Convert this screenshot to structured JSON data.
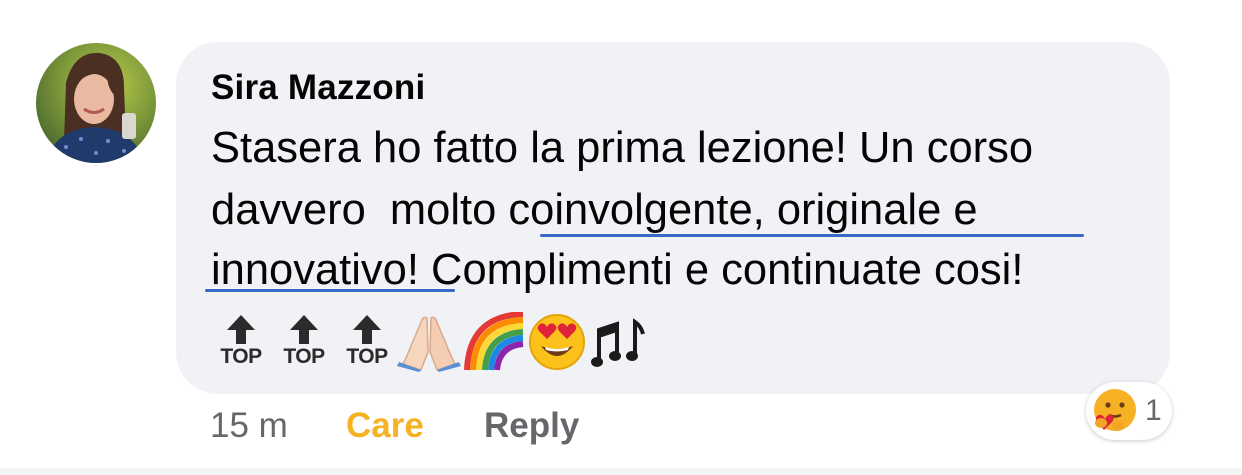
{
  "comment": {
    "author": "Sira Mazzoni",
    "lines": [
      "Stasera ho fatto la prima lezione! Un corso",
      "davvero  molto coinvolgente, originale e",
      "innovativo! Complimenti e continuate cosi!"
    ],
    "top_badges": [
      "TOP",
      "TOP",
      "TOP"
    ],
    "emoji_icons": [
      "folded-hands-icon",
      "rainbow-icon",
      "heart-eyes-icon",
      "musical-notes-icon"
    ],
    "underline_color": "#3a67c8"
  },
  "meta": {
    "time": "15 m",
    "reaction_label": "Care",
    "reply_label": "Reply"
  },
  "reactions": {
    "icon": "care-hug-icon",
    "count": "1"
  },
  "colors": {
    "bubble": "#f0f2f5",
    "care": "#f7b125",
    "secondary_text": "#65676b"
  }
}
